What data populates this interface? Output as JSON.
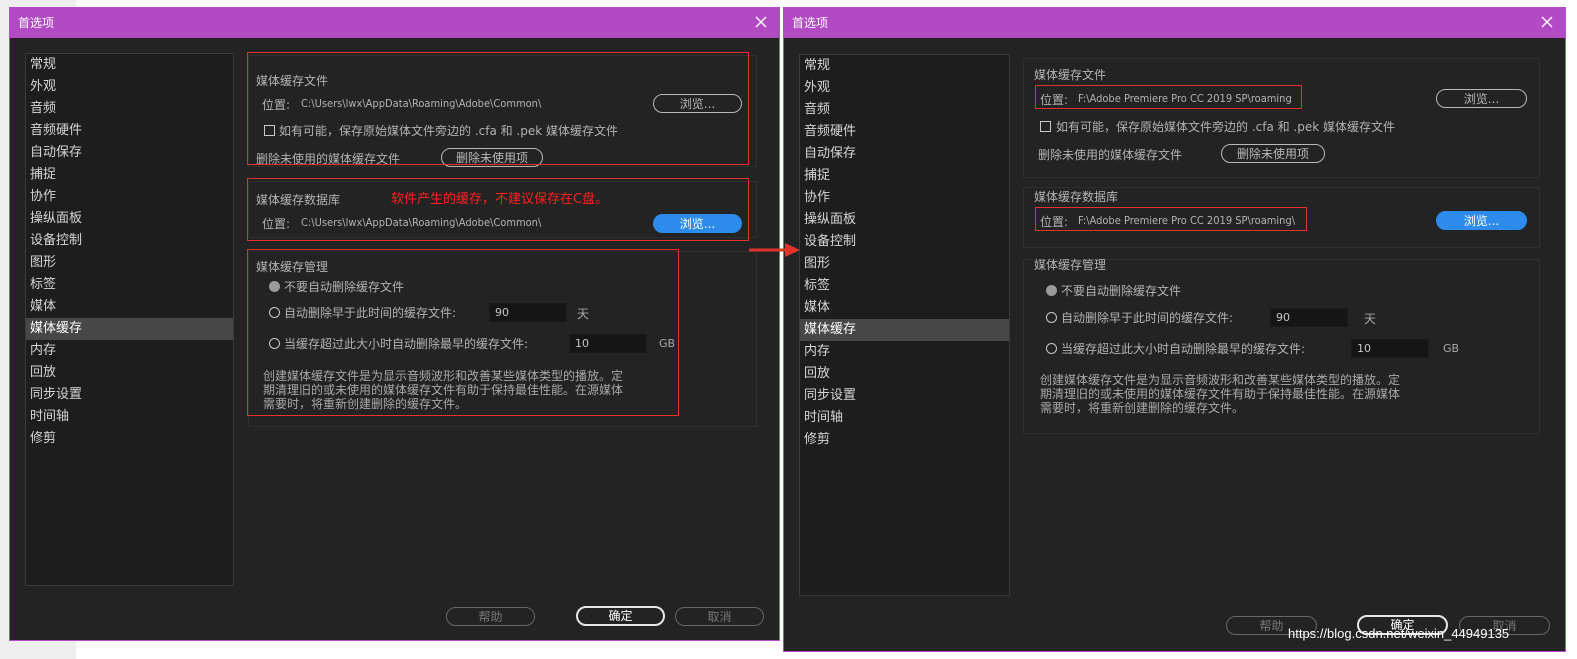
{
  "colors": {
    "titlebar": "#b24bc3",
    "dialog_bg": "#232323",
    "primary_button": "#2d8ceb",
    "highlight": "#e0332c",
    "annotation": "#ff2020"
  },
  "icons": [
    "close-icon",
    "arrow-right-icon"
  ],
  "dialog_title": "首选项",
  "nav_items": [
    "常规",
    "外观",
    "音频",
    "音频硬件",
    "自动保存",
    "捕捉",
    "协作",
    "操纵面板",
    "设备控制",
    "图形",
    "标签",
    "媒体",
    "媒体缓存",
    "内存",
    "回放",
    "同步设置",
    "时间轴",
    "修剪"
  ],
  "nav_selected": "媒体缓存",
  "cache_files": {
    "title": "媒体缓存文件",
    "location_prefix": "位置:",
    "checkbox_label": "如有可能，保存原始媒体文件旁边的 .cfa 和 .pek 媒体缓存文件",
    "delete_label": "删除未使用的媒体缓存文件",
    "delete_button": "删除未使用项"
  },
  "cache_db": {
    "title": "媒体缓存数据库",
    "location_prefix": "位置:"
  },
  "browse_button": "浏览...",
  "cache_management": {
    "title": "媒体缓存管理",
    "option_never": "不要自动删除缓存文件",
    "option_older": "自动删除早于此时间的缓存文件:",
    "older_value": "90",
    "older_unit": "天",
    "option_size": "当缓存超过此大小时自动删除最早的缓存文件:",
    "size_value": "10",
    "size_unit": "GB",
    "description_lines": [
      "创建媒体缓存文件是为显示音频波形和改善某些媒体类型的播放。定",
      "期清理旧的或未使用的媒体缓存文件有助于保持最佳性能。在源媒体",
      "需要时，将重新创建删除的缓存文件。"
    ]
  },
  "buttons": {
    "help": "帮助",
    "ok": "确定",
    "cancel": "取消"
  },
  "left": {
    "cache_files_location": "C:\\Users\\lwx\\AppData\\Roaming\\Adobe\\Common\\",
    "cache_db_location": "C:\\Users\\lwx\\AppData\\Roaming\\Adobe\\Common\\",
    "annotation": "软件产生的缓存，不建议保存在C盘。"
  },
  "right": {
    "cache_files_location": "F:\\Adobe Premiere Pro CC 2019 SP\\roaming",
    "cache_db_location": "F:\\Adobe Premiere Pro CC 2019 SP\\roaming\\"
  },
  "watermark": "https://blog.csdn.net/weixin_44949135"
}
